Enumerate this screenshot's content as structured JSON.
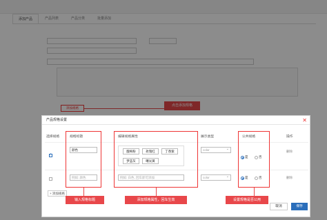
{
  "background": {
    "tabs": [
      "添加产品",
      "产品列表",
      "产品分类",
      "批量添加"
    ],
    "row_labels": [
      "",
      "",
      "",
      ""
    ],
    "category_select": "",
    "add_spec_button": "添加规格",
    "callout_add_spec": "点击添加规格"
  },
  "dialog": {
    "title": "产品规格设置",
    "close_symbol": "✕",
    "headers": {
      "select": "选择规格",
      "spec_title": "规格标题",
      "edit_attr": "编辑规格属性",
      "display_type": "展示类型",
      "public_spec": "公共规格",
      "action": "操作"
    },
    "rows": [
      {
        "checked": true,
        "title_value": "颜色",
        "attributes": [
          "酸梅粉",
          "玫瑰红",
          "丁香紫",
          "梦蓝灰",
          "曙光黄"
        ],
        "display_value": "color",
        "public_yes": "是",
        "public_no": "否",
        "public_selected": "yes",
        "delete_label": "删除"
      },
      {
        "checked": false,
        "title_placeholder": "例如: 颜色",
        "attr_placeholder": "例如: 白色, 回车即可添加",
        "display_value": "color",
        "public_yes": "是",
        "public_no": "否",
        "public_selected": "yes",
        "delete_label": "删除"
      }
    ],
    "add_spec_link": "+ 添加规格",
    "cancel_label": "取消",
    "confirm_label": "保存"
  },
  "annotations": {
    "input_title": "输入规格标题",
    "add_attr": "添加规格属性，回车生效",
    "set_public": "设置规格是否公用"
  },
  "colors": {
    "accent_red": "#e8474a",
    "primary_blue": "#2a6ebb"
  }
}
